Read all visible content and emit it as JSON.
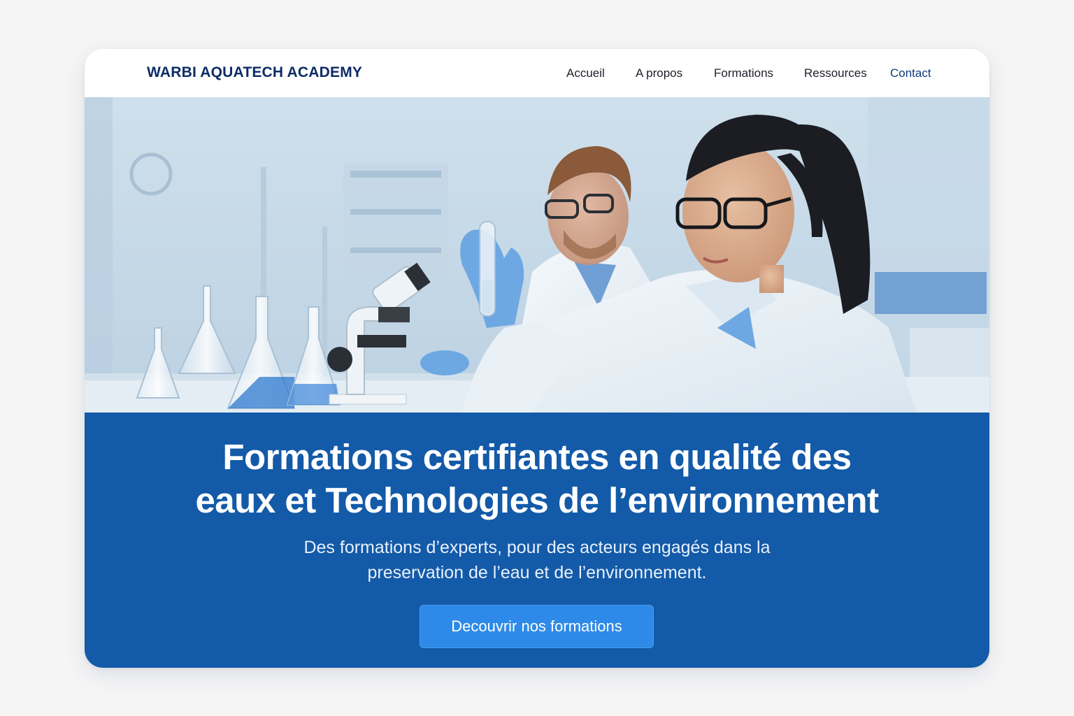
{
  "brand": {
    "name": "WARBI AQUATECH ACADEMY",
    "color": "#0d2c66"
  },
  "nav": {
    "items": [
      {
        "label": "Accueil"
      },
      {
        "label": "A propos"
      },
      {
        "label": "Formations"
      },
      {
        "label": "Ressources"
      },
      {
        "label": "Contact"
      }
    ]
  },
  "hero": {
    "image_subject": "two scientists in lab coats with test tube and microscope in a laboratory",
    "title": "Formations certifiantes en qualité des\neaux et Technologies de l’environnement",
    "subtitle": "Des formations d’experts, pour des acteurs engagés dans la\npreservation de l’eau et de l’environnement.",
    "cta_label": "Decouvrir nos formations"
  },
  "colors": {
    "band": "#135aa8",
    "cta": "#2e8ae8",
    "page_background": "#f5f5f6"
  }
}
